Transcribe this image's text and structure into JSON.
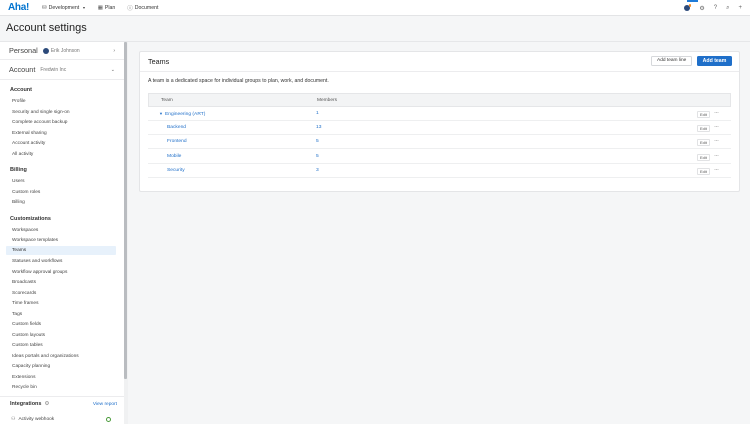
{
  "nav": {
    "logo": "Aha!",
    "items": [
      {
        "icon": "workspace-icon",
        "label": "Development",
        "has_caret": true
      },
      {
        "icon": "plan-icon",
        "label": "Plan"
      },
      {
        "icon": "document-icon",
        "label": "Document"
      }
    ]
  },
  "page": {
    "title": "Account settings"
  },
  "sidebar": {
    "personal": {
      "label": "Personal",
      "user": "Erik Johnson"
    },
    "account": {
      "label": "Account",
      "org": "Fredwin Inc"
    },
    "sections": [
      {
        "heading": "Account",
        "items": [
          "Profile",
          "Security and single sign-on",
          "Complete account backup",
          "External sharing",
          "Account activity",
          "All activity"
        ]
      },
      {
        "heading": "Billing",
        "items": [
          "Users",
          "Custom roles",
          "Billing"
        ]
      },
      {
        "heading": "Customizations",
        "items": [
          "Workspaces",
          "Workspace templates",
          "Teams",
          "Statuses and workflows",
          "Workflow approval groups",
          "Broadcasts",
          "Scorecards",
          "Time frames",
          "Tags",
          "Custom fields",
          "Custom layouts",
          "Custom tables",
          "Ideas portals and organizations",
          "Capacity planning",
          "Extensions",
          "Recycle bin"
        ]
      }
    ],
    "active_item": "Teams",
    "integrations": {
      "heading": "Integrations",
      "view_report": "View report",
      "first_item": "Activity webhook"
    }
  },
  "teams": {
    "title": "Teams",
    "add_line_label": "Add team line",
    "add_team_label": "Add team",
    "description": "A team is a dedicated space for individual groups to plan, work, and document.",
    "columns": [
      "Team",
      "Members"
    ],
    "edit_label": "Edit",
    "more_label": "···",
    "rows": [
      {
        "name": "Engineering (ART)",
        "members": "1",
        "is_group": true
      },
      {
        "name": "Backend",
        "members": "13",
        "is_group": false
      },
      {
        "name": "Frontend",
        "members": "5",
        "is_group": false
      },
      {
        "name": "Mobile",
        "members": "5",
        "is_group": false
      },
      {
        "name": "Security",
        "members": "3",
        "is_group": false
      }
    ]
  }
}
